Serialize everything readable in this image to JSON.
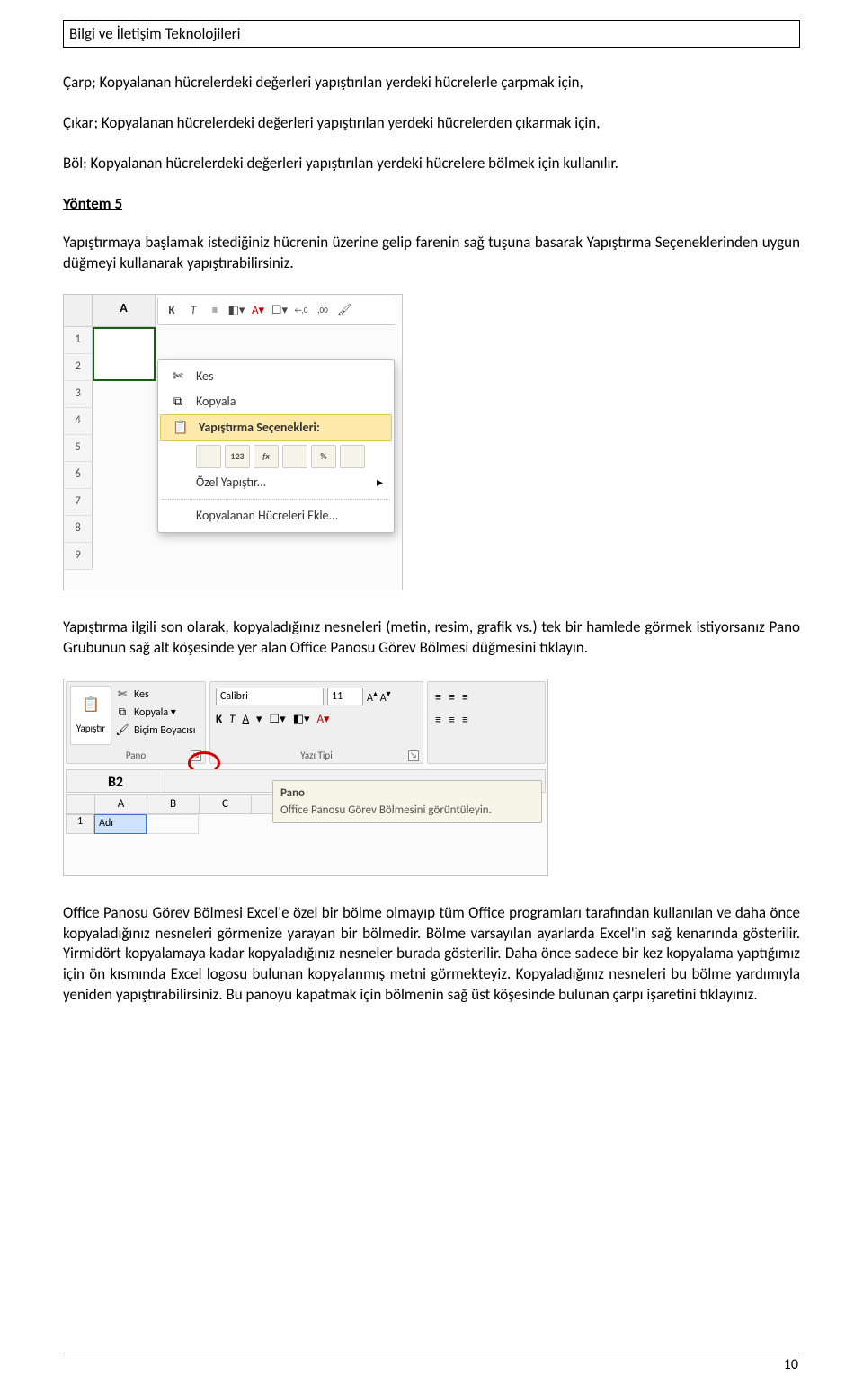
{
  "header": {
    "title": "Bilgi ve İletişim Teknolojileri"
  },
  "para1": "Çarp; Kopyalanan hücrelerdeki değerleri yapıştırılan yerdeki hücrelerle çarpmak için,",
  "para2": "Çıkar; Kopyalanan hücrelerdeki değerleri yapıştırılan yerdeki hücrelerden çıkarmak için,",
  "para3": "Böl; Kopyalanan hücrelerdeki değerleri yapıştırılan yerdeki hücrelere bölmek için kullanılır.",
  "yontem5": "Yöntem 5",
  "para4": "Yapıştırmaya başlamak istediğiniz hücrenin üzerine gelip farenin sağ tuşuna basarak Yapıştırma Seçeneklerinden uygun düğmeyi kullanarak yapıştırabilirsiniz.",
  "fig1": {
    "namebox": "",
    "col_a": "A",
    "rows": [
      "1",
      "2",
      "3",
      "4",
      "5",
      "6",
      "7",
      "8",
      "9"
    ],
    "mini_toolbar": {
      "bold": "K",
      "italic": "T",
      "a_letter": "A",
      "inc_dec1": "←,0",
      "inc_dec2": ",00"
    },
    "menu": {
      "kes": "Kes",
      "kopyala": "Kopyala",
      "paste_title": "Yapıştırma Seçenekleri:",
      "paste_btns": [
        "",
        "123",
        "fx",
        "",
        "%",
        ""
      ],
      "ozel": "Özel Yapıştır...",
      "kopya_ekle": "Kopyalanan Hücreleri Ekle..."
    }
  },
  "para5": "Yapıştırma ilgili son olarak, kopyaladığınız nesneleri (metin, resim, grafik vs.) tek bir hamlede görmek istiyorsanız Pano Grubunun sağ alt köşesinde yer alan Office Panosu Görev Bölmesi düğmesini tıklayın.",
  "fig2": {
    "groups": {
      "pano": "Pano",
      "font": "Yazı Tipi"
    },
    "yapistir": "Yapıştır",
    "kes": "Kes",
    "kopyala": "Kopyala ▾",
    "bicim": "Biçim Boyacısı",
    "font_name": "Calibri",
    "font_size": "11",
    "font_btns": {
      "bold": "K",
      "italic": "T",
      "underline": "A"
    },
    "cell_ref": "B2",
    "cols": [
      "",
      "A",
      "B",
      "C"
    ],
    "row1_num": "1",
    "adi": "Adı",
    "tooltip_title": "Pano",
    "tooltip_text": "Office Panosu Görev Bölmesini görüntüleyin."
  },
  "para6": "Office Panosu Görev Bölmesi Excel'e özel bir bölme olmayıp tüm Office programları tarafından kullanılan ve daha önce kopyaladığınız nesneleri görmenize yarayan bir bölmedir. Bölme varsayılan ayarlarda Excel'in sağ kenarında gösterilir. Yirmidört kopyalamaya kadar kopyaladığınız nesneler burada gösterilir. Daha önce sadece bir kez kopyalama yaptığımız için ön kısmında Excel logosu bulunan kopyalanmış metni görmekteyiz. Kopyaladığınız nesneleri bu bölme yardımıyla yeniden yapıştırabilirsiniz. Bu panoyu kapatmak için bölmenin sağ üst köşesinde bulunan çarpı işaretini tıklayınız.",
  "page_number": "10"
}
